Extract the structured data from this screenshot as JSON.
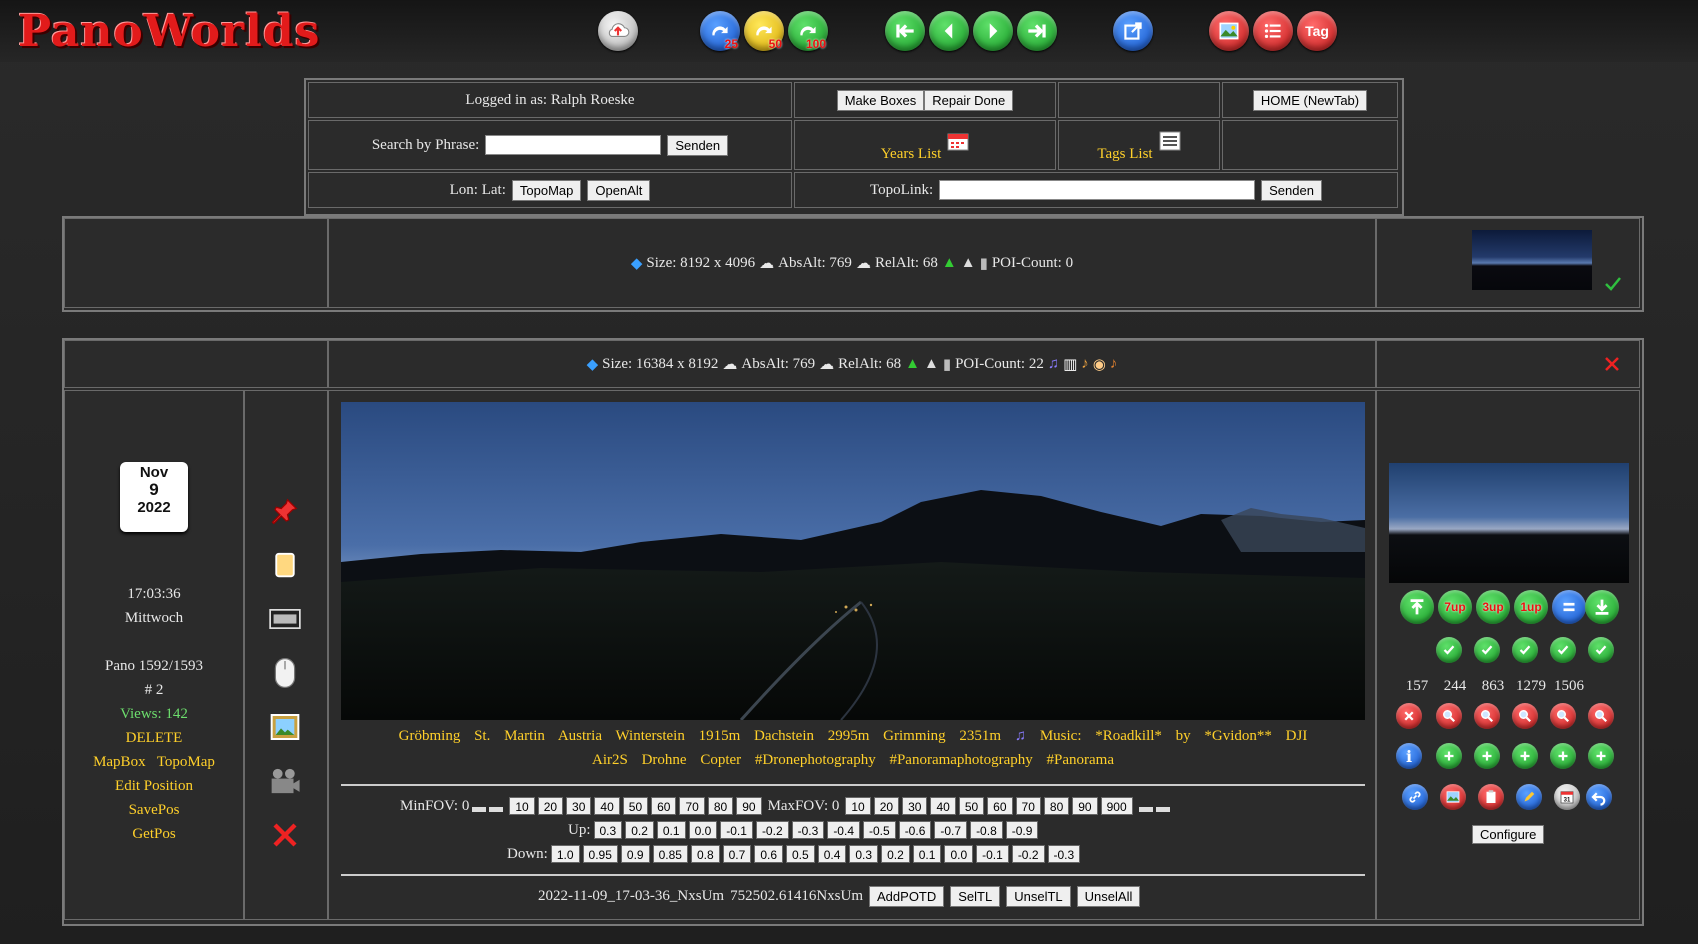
{
  "logo": "PanoWorlds",
  "header_buttons": [
    {
      "name": "upload-cloud-icon",
      "color": "w",
      "label": ""
    },
    {
      "name": "redo-25-button",
      "color": "b",
      "label": "25"
    },
    {
      "name": "redo-50-button",
      "color": "y",
      "label": "50"
    },
    {
      "name": "redo-100-button",
      "color": "g",
      "label": "100"
    },
    {
      "name": "first-button",
      "color": "g",
      "label": ""
    },
    {
      "name": "prev-button",
      "color": "g",
      "label": ""
    },
    {
      "name": "next-button",
      "color": "g",
      "label": ""
    },
    {
      "name": "last-button",
      "color": "g",
      "label": ""
    },
    {
      "name": "open-external-button",
      "color": "b",
      "label": ""
    },
    {
      "name": "image-button",
      "color": "r",
      "label": ""
    },
    {
      "name": "list-button",
      "color": "r",
      "label": ""
    },
    {
      "name": "tag-button",
      "color": "r",
      "label": "Tag"
    }
  ],
  "toptable": {
    "logged_in": "Logged in as: Ralph Roeske",
    "make_boxes": "Make Boxes",
    "repair_done": "Repair Done",
    "home_newtab": "HOME (NewTab)",
    "search_label": "Search by Phrase:",
    "search_value": "",
    "senden": "Senden",
    "years_list": "Years List",
    "tags_list": "Tags List",
    "lonlat_label": "Lon: Lat:",
    "topomap": "TopoMap",
    "openalt": "OpenAlt",
    "topolink_label": "TopoLink:",
    "topolink_value": "",
    "senden2": "Senden"
  },
  "pano1": {
    "size": "Size: 8192 x 4096",
    "absalt": "AbsAlt: 769",
    "relalt": "RelAlt: 68",
    "poi": "POI-Count: 0"
  },
  "pano2": {
    "size": "Size: 16384 x 8192",
    "absalt": "AbsAlt: 769",
    "relalt": "RelAlt: 68",
    "poi": "POI-Count: 22",
    "date": {
      "month": "Nov",
      "day": "9",
      "year": "2022"
    },
    "time": "17:03:36",
    "weekday": "Mittwoch",
    "pano_index": "Pano 1592/1593",
    "number": "# 2",
    "views": "Views: 142",
    "delete": "DELETE",
    "mapbox": "MapBox",
    "topomap": "TopoMap",
    "edit_position": "Edit Position",
    "savepos": "SavePos",
    "getpos": "GetPos",
    "caption_line1": "Gröbming St. Martin Austria Winterstein 1915m Dachstein 2995m Grimming 2351m",
    "caption_music": "Music: *Roadkill* by *Gvidon** DJI",
    "caption_line2": "Air2S Drohne Copter #Dronephotography #Panoramaphotography #Panorama",
    "minfov_label": "MinFOV: 0",
    "minfov_values": [
      "10",
      "20",
      "30",
      "40",
      "50",
      "60",
      "70",
      "80",
      "90"
    ],
    "maxfov_label": "MaxFOV: 0",
    "maxfov_values": [
      "10",
      "20",
      "30",
      "40",
      "50",
      "60",
      "70",
      "80",
      "90",
      "900"
    ],
    "up_label": "Up:",
    "up_values": [
      "0.3",
      "0.2",
      "0.1",
      "0.0",
      "-0.1",
      "-0.2",
      "-0.3",
      "-0.4",
      "-0.5",
      "-0.6",
      "-0.7",
      "-0.8",
      "-0.9"
    ],
    "down_label": "Down:",
    "down_values": [
      "1.0",
      "0.95",
      "0.9",
      "0.85",
      "0.8",
      "0.7",
      "0.6",
      "0.5",
      "0.4",
      "0.3",
      "0.2",
      "0.1",
      "0.0",
      "-0.1",
      "-0.2",
      "-0.3"
    ],
    "filename": "2022-11-09_17-03-36_NxsUm",
    "fileid": "752502.61416NxsUm",
    "addpotd": "AddPOTD",
    "seltl": "SelTL",
    "unseltl": "UnselTL",
    "unselall": "UnselAll",
    "counts": [
      "157",
      "244",
      "863",
      "1279",
      "1506"
    ],
    "configure": "Configure",
    "up_buttons": [
      "7up",
      "3up",
      "1up"
    ]
  },
  "colors": {
    "gold": "#ffd02a",
    "green": "#6dde6d",
    "red": "#e21b1b"
  }
}
